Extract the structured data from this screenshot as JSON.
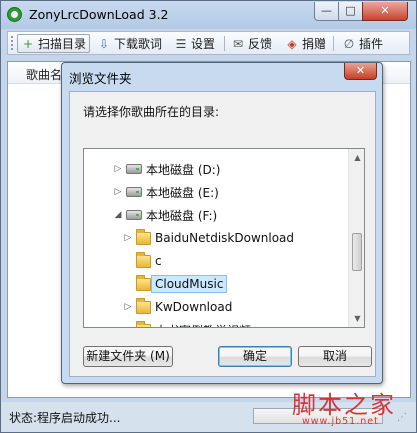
{
  "window": {
    "title": "ZonyLrcDownLoad 3.2",
    "controls": {
      "minimize": "—",
      "maximize": "□",
      "close": "✕"
    }
  },
  "toolbar": {
    "items": [
      {
        "label": "扫描目录",
        "icon": "plus-icon",
        "glyph": "+",
        "color": "#2f9a3a"
      },
      {
        "label": "下载歌词",
        "icon": "download-icon",
        "glyph": "⇩",
        "color": "#2c6fb8"
      },
      {
        "label": "设置",
        "icon": "settings-icon",
        "glyph": "☰",
        "color": "#444444"
      },
      {
        "label": "反馈",
        "icon": "mail-icon",
        "glyph": "✉",
        "color": "#555555"
      },
      {
        "label": "捐赠",
        "icon": "tag-icon",
        "glyph": "◈",
        "color": "#c0392b"
      },
      {
        "label": "插件",
        "icon": "paperclip-icon",
        "glyph": "∅",
        "color": "#555555"
      }
    ]
  },
  "list": {
    "column_song": "歌曲名"
  },
  "status": {
    "text": "状态:程序启动成功...",
    "progress": 0
  },
  "dialog": {
    "title": "浏览文件夹",
    "close": "✕",
    "prompt": "请选择你歌曲所在的目录:",
    "tree": [
      {
        "label": "本地磁盘 (D:)",
        "type": "drive",
        "level": 0,
        "expander": "▷"
      },
      {
        "label": "本地磁盘 (E:)",
        "type": "drive",
        "level": 0,
        "expander": "▷"
      },
      {
        "label": "本地磁盘 (F:)",
        "type": "drive",
        "level": 0,
        "expander": "◢"
      },
      {
        "label": "BaiduNetdiskDownload",
        "type": "folder",
        "level": 1,
        "expander": "▷"
      },
      {
        "label": "c",
        "type": "folder",
        "level": 1,
        "expander": ""
      },
      {
        "label": "CloudMusic",
        "type": "folder",
        "level": 1,
        "expander": "",
        "selected": true
      },
      {
        "label": "KwDownload",
        "type": "folder",
        "level": 1,
        "expander": "▷"
      },
      {
        "label": "本书案例教学视频",
        "type": "folder",
        "level": 1,
        "expander": ""
      }
    ],
    "scroll": {
      "up": "▲",
      "down": "▼"
    },
    "buttons": {
      "new_folder": "新建文件夹 (M)",
      "ok": "确定",
      "cancel": "取消"
    }
  },
  "watermark": {
    "main": "脚本之家",
    "sub": "www.jb51.net"
  }
}
